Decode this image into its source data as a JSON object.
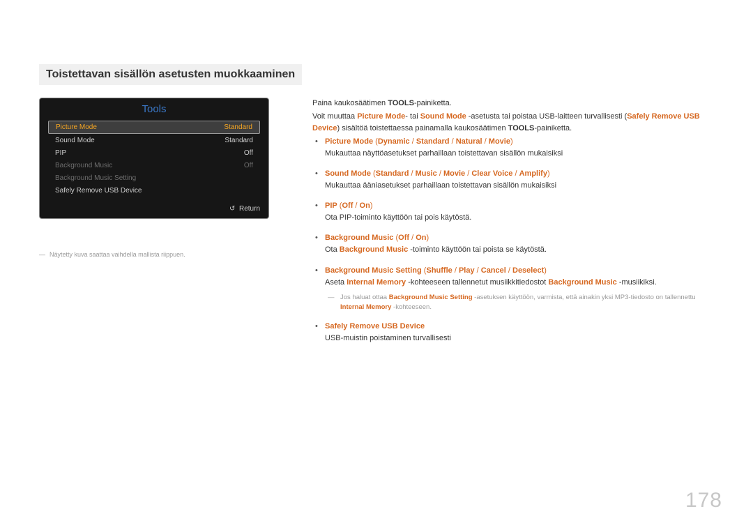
{
  "heading": "Toistettavan sisällön asetusten muokkaaminen",
  "tools": {
    "title": "Tools",
    "rows": [
      {
        "label": "Picture Mode",
        "value": "Standard",
        "hl": true
      },
      {
        "label": "Sound Mode",
        "value": "Standard",
        "hl": false
      },
      {
        "label": "PIP",
        "value": "Off",
        "hl": false
      },
      {
        "label": "Background Music",
        "value": "Off",
        "dim": true
      },
      {
        "label": "Background Music Setting",
        "value": "",
        "dim": true
      },
      {
        "label": "Safely Remove USB Device",
        "value": "",
        "hl": false
      }
    ],
    "return": "Return"
  },
  "caption": "Näytetty kuva saattaa vaihdella mallista riippuen.",
  "para1": {
    "t1": "Paina kaukosäätimen ",
    "b1": "TOOLS",
    "t2": "-painiketta."
  },
  "para2": {
    "t1": "Voit muuttaa ",
    "o1": "Picture Mode",
    "t2": "- tai ",
    "o2": "Sound Mode",
    "t3": " -asetusta tai poistaa USB-laitteen turvallisesti (",
    "o3": "Safely Remove USB Device",
    "t4": ") sisältöä toistettaessa painamalla kaukosäätimen ",
    "b1": "TOOLS",
    "t5": "-painiketta."
  },
  "items": [
    {
      "head": [
        "Picture Mode",
        " (",
        "Dynamic",
        " / ",
        "Standard",
        " / ",
        "Natural",
        " / ",
        "Movie",
        ")"
      ],
      "desc": "Mukauttaa näyttöasetukset parhaillaan toistettavan sisällön mukaisiksi"
    },
    {
      "head": [
        "Sound Mode",
        " (",
        "Standard",
        " / ",
        "Music",
        " / ",
        "Movie",
        " / ",
        "Clear Voice",
        " / ",
        "Amplify",
        ")"
      ],
      "desc": "Mukauttaa ääniasetukset parhaillaan toistettavan sisällön mukaisiksi"
    },
    {
      "head": [
        "PIP",
        " (",
        "Off",
        " / ",
        "On",
        ")"
      ],
      "desc": "Ota PIP-toiminto käyttöön tai pois käytöstä."
    },
    {
      "head": [
        "Background Music",
        " (",
        "Off",
        " / ",
        "On",
        ")"
      ],
      "desc_pre": "Ota ",
      "desc_o": "Background Music",
      "desc_post": " -toiminto käyttöön tai poista se käytöstä."
    },
    {
      "head": [
        "Background Music Setting",
        " (",
        "Shuffle",
        " / ",
        "Play",
        " / ",
        "Cancel",
        " / ",
        "Deselect",
        ")"
      ],
      "desc_pre": "Aseta ",
      "desc_o": "Internal Memory",
      "desc_mid": " -kohteeseen tallennetut musiikkitiedostot ",
      "desc_o2": "Background Music",
      "desc_post": " -musiikiksi.",
      "note": {
        "t1": "Jos haluat ottaa ",
        "o1": "Background Music Setting",
        "t2": " -asetuksen käyttöön, varmista, että ainakin yksi MP3-tiedosto on tallennettu ",
        "o2": "Internal Memory",
        "t3": " -kohteeseen."
      }
    },
    {
      "head": [
        "Safely Remove USB Device"
      ],
      "desc": "USB-muistin poistaminen turvallisesti"
    }
  ],
  "page_num": "178"
}
